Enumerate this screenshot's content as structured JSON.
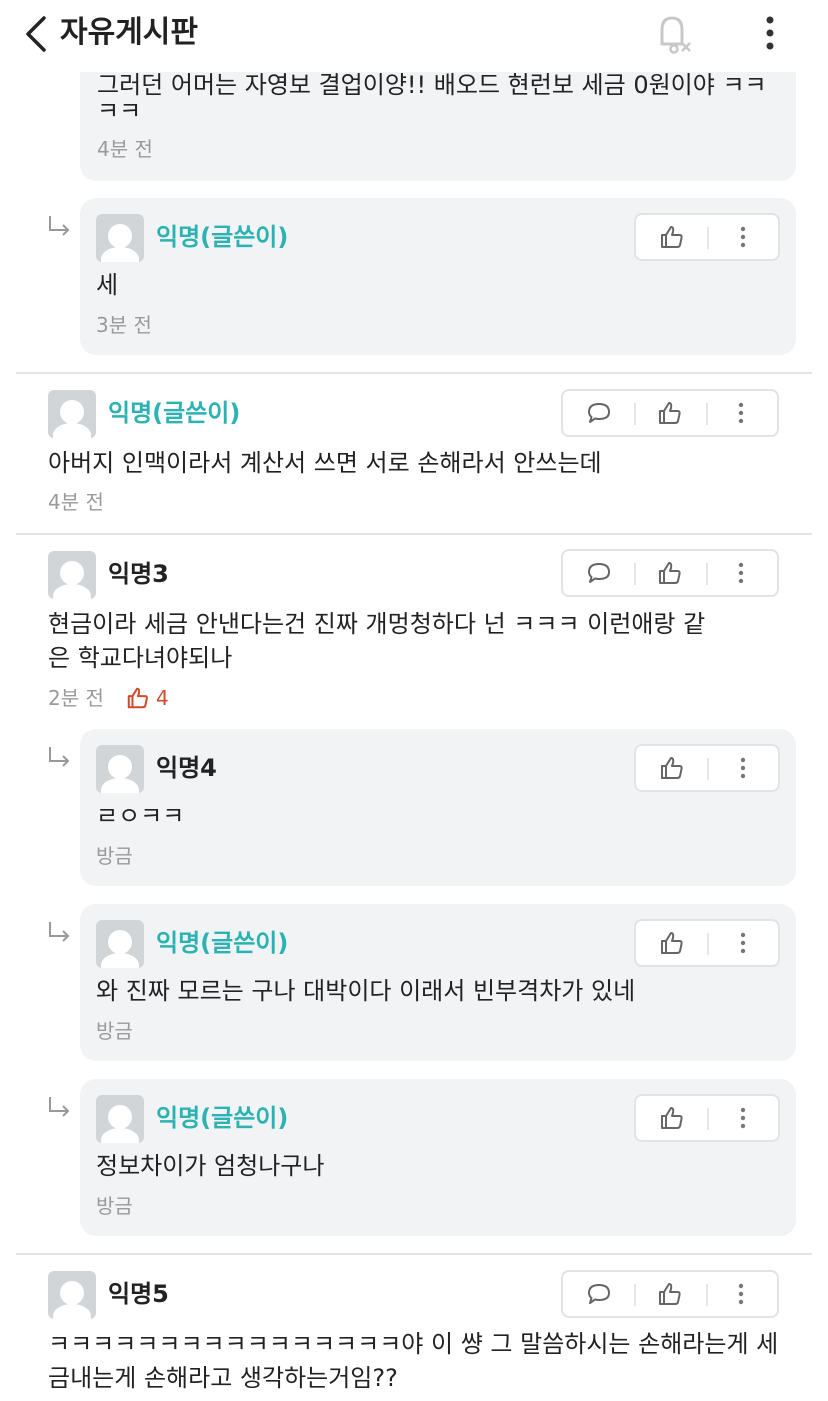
{
  "header": {
    "title": "자유게시판",
    "icons": [
      "back-icon",
      "notification-off-icon",
      "more-icon"
    ]
  },
  "comments": [
    {
      "text": "그러던 어머는 자영보 결업이양!! 배오드 현런보 세금 0원이야 ㅋㅋ",
      "text_line2": "ㅋㅋ",
      "time": "4분 전"
    },
    {
      "author": "익명(글쓴이)",
      "text": "세",
      "time": "3분 전"
    },
    {
      "author": "익명(글쓴이)",
      "text": "아버지 인맥이라서 계산서 쓰면 서로 손해라서 안쓰는데",
      "time": "4분 전"
    },
    {
      "author": "익명3",
      "text_line1": "현금이라 세금 안낸다는건 진짜 개멍청하다 넌 ㅋㅋㅋ 이런애랑 같",
      "text_line2": "은 학교다녀야되나",
      "time": "2분 전",
      "likes": "4"
    },
    {
      "author": "익명4",
      "text": "ㄹㅇㅋㅋ",
      "time": "방금"
    },
    {
      "author": "익명(글쓴이)",
      "text": "와 진짜 모르는 구나 대박이다 이래서 빈부격차가 있네",
      "time": "방금"
    },
    {
      "author": "익명(글쓴이)",
      "text": "정보차이가 엄청나구나",
      "time": "방금"
    },
    {
      "author": "익명5",
      "text_line1": "ㅋㅋㅋㅋㅋㅋㅋㅋㅋㅋㅋㅋㅋㅋㅋㅋ야 이 썅 그 말씀하시는 손해라는게 세",
      "text_line2": "금내는게 손해라고 생각하는거임??"
    }
  ],
  "colors": {
    "writer": "#2bb3b3",
    "like": "#d24a2a",
    "reply_bg": "#f2f3f5"
  }
}
